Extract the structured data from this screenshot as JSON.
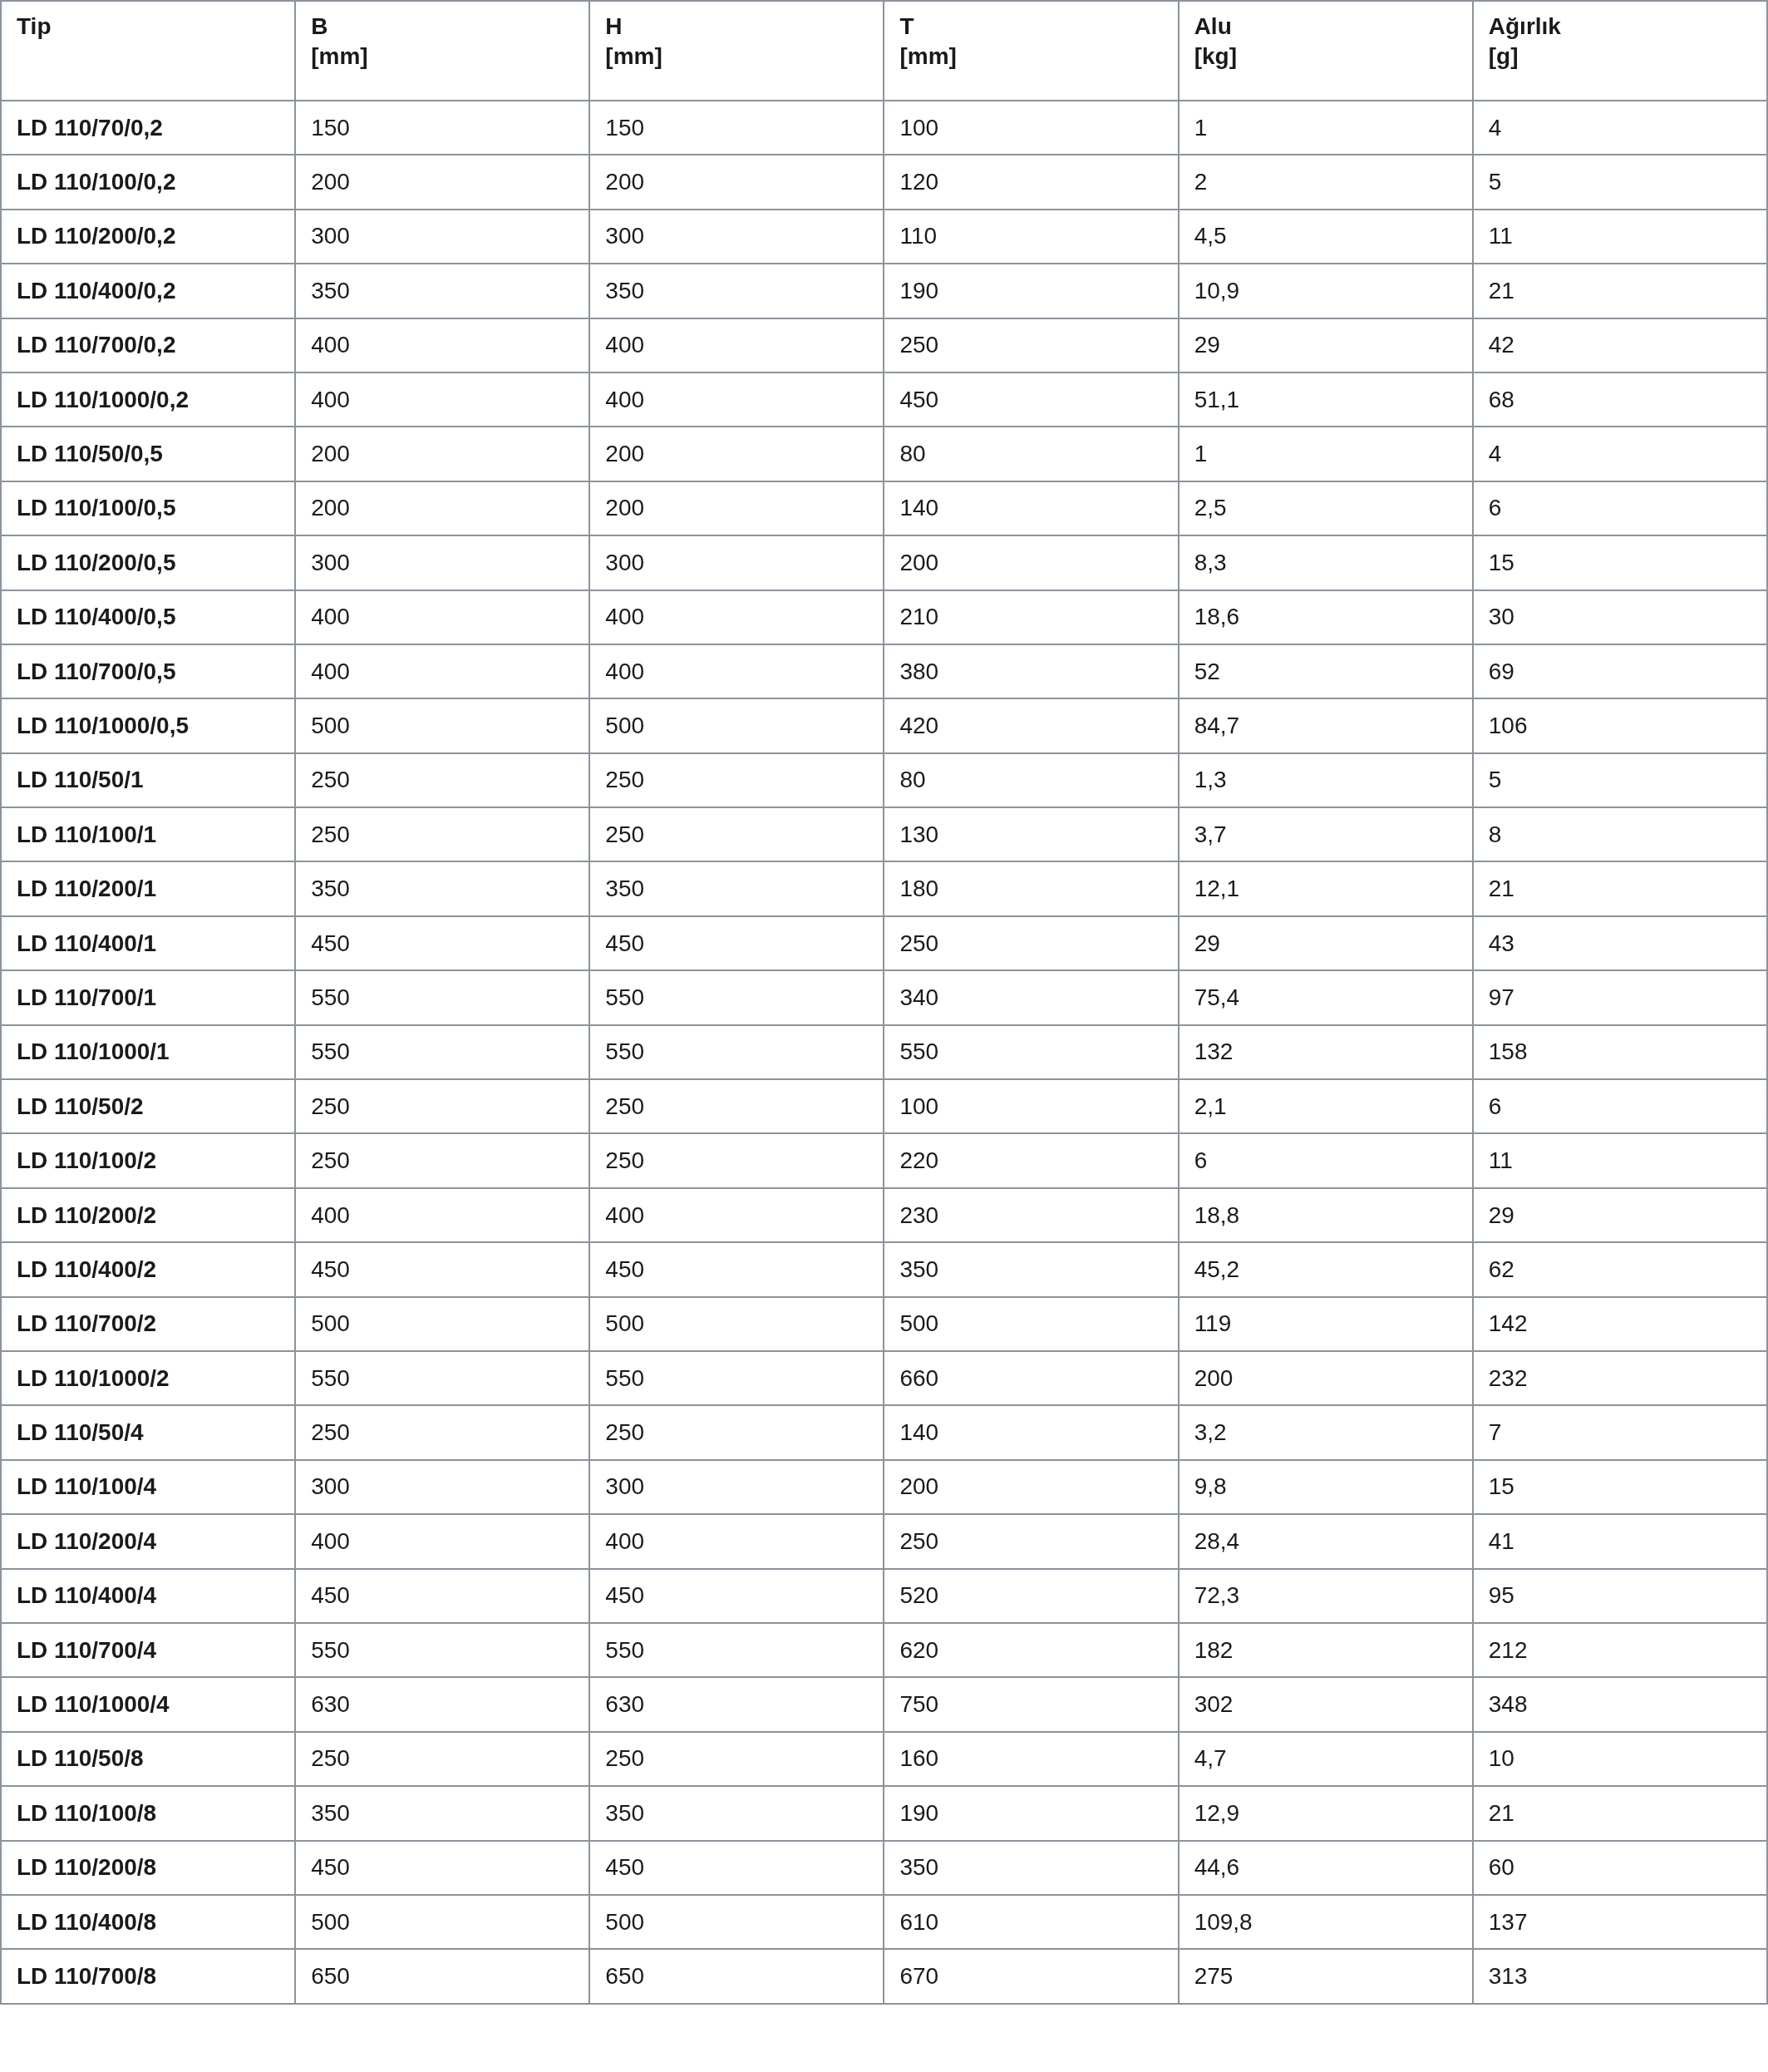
{
  "table": {
    "columns": [
      {
        "label": "Tip"
      },
      {
        "label": "B",
        "unit": "[mm]"
      },
      {
        "label": "H",
        "unit": "[mm]"
      },
      {
        "label": "T",
        "unit": "[mm]"
      },
      {
        "label": "Alu",
        "unit": "[kg]"
      },
      {
        "label": "Ağırlık",
        "unit": "[g]"
      }
    ],
    "rows": [
      [
        "LD 110/70/0,2",
        "150",
        "150",
        "100",
        "1",
        "4"
      ],
      [
        "LD 110/100/0,2",
        "200",
        "200",
        "120",
        "2",
        "5"
      ],
      [
        "LD 110/200/0,2",
        "300",
        "300",
        "110",
        "4,5",
        "11"
      ],
      [
        "LD 110/400/0,2",
        "350",
        "350",
        "190",
        "10,9",
        "21"
      ],
      [
        "LD 110/700/0,2",
        "400",
        "400",
        "250",
        "29",
        "42"
      ],
      [
        "LD 110/1000/0,2",
        "400",
        "400",
        "450",
        "51,1",
        "68"
      ],
      [
        "LD 110/50/0,5",
        "200",
        "200",
        "80",
        "1",
        "4"
      ],
      [
        "LD 110/100/0,5",
        "200",
        "200",
        "140",
        "2,5",
        "6"
      ],
      [
        "LD 110/200/0,5",
        "300",
        "300",
        "200",
        "8,3",
        "15"
      ],
      [
        "LD 110/400/0,5",
        "400",
        "400",
        "210",
        "18,6",
        "30"
      ],
      [
        "LD 110/700/0,5",
        "400",
        "400",
        "380",
        "52",
        "69"
      ],
      [
        "LD 110/1000/0,5",
        "500",
        "500",
        "420",
        "84,7",
        "106"
      ],
      [
        "LD 110/50/1",
        "250",
        "250",
        "80",
        "1,3",
        "5"
      ],
      [
        "LD 110/100/1",
        "250",
        "250",
        "130",
        "3,7",
        "8"
      ],
      [
        "LD 110/200/1",
        "350",
        "350",
        "180",
        "12,1",
        "21"
      ],
      [
        "LD 110/400/1",
        "450",
        "450",
        "250",
        "29",
        "43"
      ],
      [
        "LD 110/700/1",
        "550",
        "550",
        "340",
        "75,4",
        "97"
      ],
      [
        "LD 110/1000/1",
        "550",
        "550",
        "550",
        "132",
        "158"
      ],
      [
        "LD 110/50/2",
        "250",
        "250",
        "100",
        "2,1",
        "6"
      ],
      [
        "LD 110/100/2",
        "250",
        "250",
        "220",
        "6",
        "11"
      ],
      [
        "LD 110/200/2",
        "400",
        "400",
        "230",
        "18,8",
        "29"
      ],
      [
        "LD 110/400/2",
        "450",
        "450",
        "350",
        "45,2",
        "62"
      ],
      [
        "LD 110/700/2",
        "500",
        "500",
        "500",
        "119",
        "142"
      ],
      [
        "LD 110/1000/2",
        "550",
        "550",
        "660",
        "200",
        "232"
      ],
      [
        "LD 110/50/4",
        "250",
        "250",
        "140",
        "3,2",
        "7"
      ],
      [
        "LD 110/100/4",
        "300",
        "300",
        "200",
        "9,8",
        "15"
      ],
      [
        "LD 110/200/4",
        "400",
        "400",
        "250",
        "28,4",
        "41"
      ],
      [
        "LD 110/400/4",
        "450",
        "450",
        "520",
        "72,3",
        "95"
      ],
      [
        "LD 110/700/4",
        "550",
        "550",
        "620",
        "182",
        "212"
      ],
      [
        "LD 110/1000/4",
        "630",
        "630",
        "750",
        "302",
        "348"
      ],
      [
        "LD 110/50/8",
        "250",
        "250",
        "160",
        "4,7",
        "10"
      ],
      [
        "LD 110/100/8",
        "350",
        "350",
        "190",
        "12,9",
        "21"
      ],
      [
        "LD 110/200/8",
        "450",
        "450",
        "350",
        "44,6",
        "60"
      ],
      [
        "LD 110/400/8",
        "500",
        "500",
        "610",
        "109,8",
        "137"
      ],
      [
        "LD 110/700/8",
        "650",
        "650",
        "670",
        "275",
        "313"
      ]
    ]
  }
}
